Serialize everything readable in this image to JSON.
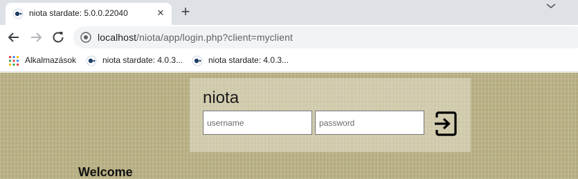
{
  "browser": {
    "tab": {
      "title": "niota stardate: 5.0.0.22040",
      "favicon": "niota-favicon-icon",
      "close": "✕"
    },
    "new_tab": "+",
    "toolbar": {
      "back": "arrow-left-icon",
      "forward": "arrow-right-icon",
      "reload": "reload-icon",
      "address": {
        "host": "localhost",
        "path": "/niota/app/login.php?client=myclient"
      }
    },
    "bookmarks": [
      {
        "label": "Alkalmazások",
        "icon": "apps-grid-icon"
      },
      {
        "label": "niota stardate: 4.0.3...",
        "icon": "niota-favicon-icon"
      },
      {
        "label": "niota stardate: 4.0.3...",
        "icon": "niota-favicon-icon"
      }
    ]
  },
  "page": {
    "login": {
      "title": "niota",
      "username_placeholder": "username",
      "password_placeholder": "password",
      "submit_icon": "login-arrow-icon"
    },
    "welcome": "Welcome"
  },
  "colors": {
    "page_background": "#bdb487",
    "login_box": "#e6e2d0",
    "tabstrip": "#dee1e6",
    "omnibox": "#f1f3f4"
  }
}
